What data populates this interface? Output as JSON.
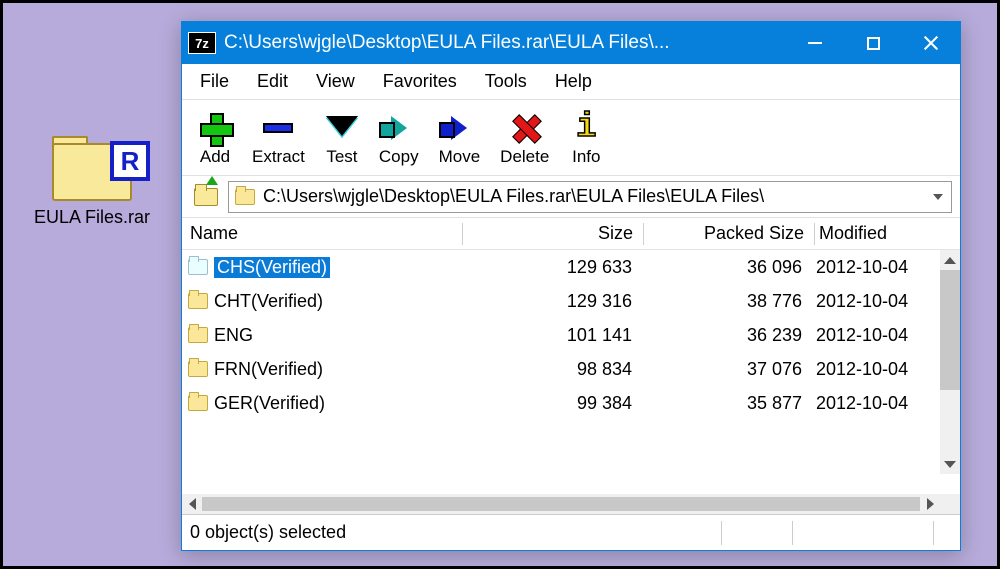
{
  "desktop": {
    "file_label": "EULA Files.rar",
    "r_badge": "R"
  },
  "window": {
    "app_icon": "7z",
    "title": "C:\\Users\\wjgle\\Desktop\\EULA Files.rar\\EULA Files\\...",
    "controls": {
      "minimize": "—",
      "maximize": "▢",
      "close": "✕"
    }
  },
  "menu": {
    "file": "File",
    "edit": "Edit",
    "view": "View",
    "favorites": "Favorites",
    "tools": "Tools",
    "help": "Help"
  },
  "toolbar": {
    "add": "Add",
    "extract": "Extract",
    "test": "Test",
    "copy": "Copy",
    "move": "Move",
    "delete": "Delete",
    "info": "Info"
  },
  "address": {
    "path": "C:\\Users\\wjgle\\Desktop\\EULA Files.rar\\EULA Files\\EULA Files\\"
  },
  "columns": {
    "name": "Name",
    "size": "Size",
    "packed": "Packed Size",
    "modified": "Modified"
  },
  "rows": [
    {
      "name": "CHS(Verified)",
      "size": "129 633",
      "packed": "36 096",
      "modified": "2012-10-04",
      "selected": true
    },
    {
      "name": "CHT(Verified)",
      "size": "129 316",
      "packed": "38 776",
      "modified": "2012-10-04",
      "selected": false
    },
    {
      "name": "ENG",
      "size": "101 141",
      "packed": "36 239",
      "modified": "2012-10-04",
      "selected": false
    },
    {
      "name": "FRN(Verified)",
      "size": "98 834",
      "packed": "37 076",
      "modified": "2012-10-04",
      "selected": false
    },
    {
      "name": "GER(Verified)",
      "size": "99 384",
      "packed": "35 877",
      "modified": "2012-10-04",
      "selected": false
    }
  ],
  "status": {
    "text": "0 object(s) selected"
  },
  "info_glyph": "i"
}
